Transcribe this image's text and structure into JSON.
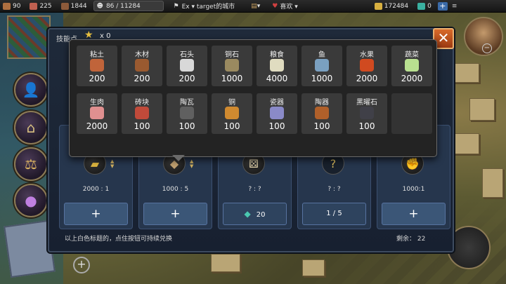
{
  "topbar": {
    "resources": [
      {
        "icon": "wood-stack-icon",
        "value": "90",
        "color": "#b07040"
      },
      {
        "icon": "meat-icon",
        "value": "225",
        "color": "#c06050"
      },
      {
        "icon": "ore-icon",
        "value": "1844",
        "color": "#8c5a3a"
      }
    ],
    "population": "86 / 11284",
    "city_menu": "Ex ▾ target的城市",
    "favorite": "喜欢 ▾",
    "gold": "172484",
    "gems": "0",
    "plus": "+"
  },
  "panel": {
    "title": "技能点",
    "count": "x 0",
    "close": "✕",
    "footnote": "以上白色标题的，点住按钮可持续兑换",
    "remaining": "剩余： 22"
  },
  "cards": [
    {
      "icon": "gold-bars-icon",
      "glyph": "▰",
      "ratio": "2000 : 1",
      "button": "+"
    },
    {
      "icon": "shield-icon",
      "glyph": "◆",
      "ratio": "1000 : 5",
      "button": "+"
    },
    {
      "icon": "dice-icon",
      "glyph": "⚄",
      "ratio": "? : ?",
      "button": "20",
      "button_icon": "gem-icon"
    },
    {
      "icon": "question-icon",
      "glyph": "?",
      "ratio": "? : ?",
      "button": "1 / 5"
    },
    {
      "icon": "fist-icon",
      "glyph": "✊",
      "ratio": "1000:1",
      "button": "+"
    }
  ],
  "popup": {
    "items": [
      {
        "name": "粘土",
        "qty": "200",
        "icon": "clay-icon",
        "color": "#c0643a"
      },
      {
        "name": "木材",
        "qty": "200",
        "icon": "wood-icon",
        "color": "#9a5a30"
      },
      {
        "name": "石头",
        "qty": "200",
        "icon": "stone-icon",
        "color": "#d8d8d8"
      },
      {
        "name": "铜石",
        "qty": "1000",
        "icon": "copper-ore-icon",
        "color": "#9a8a60"
      },
      {
        "name": "粮食",
        "qty": "4000",
        "icon": "grain-icon",
        "color": "#e0dcc0"
      },
      {
        "name": "鱼",
        "qty": "1000",
        "icon": "fish-icon",
        "color": "#7aa0c0"
      },
      {
        "name": "水果",
        "qty": "2000",
        "icon": "fruit-icon",
        "color": "#d04a20"
      },
      {
        "name": "蔬菜",
        "qty": "2000",
        "icon": "vegetable-icon",
        "color": "#b8e090"
      },
      {
        "name": "生肉",
        "qty": "2000",
        "icon": "raw-meat-icon",
        "color": "#e09090"
      },
      {
        "name": "砖块",
        "qty": "100",
        "icon": "brick-icon",
        "color": "#c04a3a"
      },
      {
        "name": "陶瓦",
        "qty": "100",
        "icon": "tile-icon",
        "color": "#606060"
      },
      {
        "name": "铜",
        "qty": "100",
        "icon": "copper-icon",
        "color": "#d08a30"
      },
      {
        "name": "瓷器",
        "qty": "100",
        "icon": "porcelain-icon",
        "color": "#8a8ac8"
      },
      {
        "name": "陶器",
        "qty": "100",
        "icon": "pottery-icon",
        "color": "#b0602a"
      },
      {
        "name": "黑曜石",
        "qty": "100",
        "icon": "obsidian-icon",
        "color": "#404048"
      }
    ]
  }
}
